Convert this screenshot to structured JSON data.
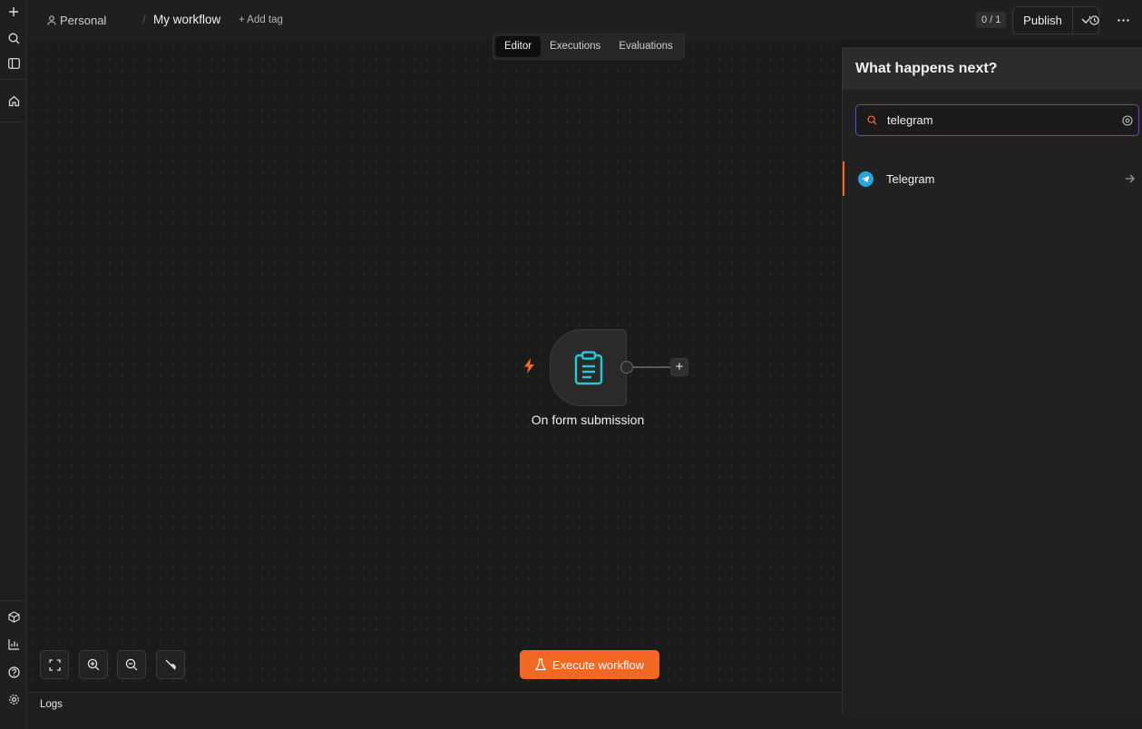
{
  "sidebar": {
    "icons": [
      "plus-icon",
      "search-icon",
      "panel-icon",
      "home-icon",
      "templates-icon",
      "insights-icon",
      "help-icon",
      "settings-icon"
    ]
  },
  "header": {
    "project": "Personal",
    "separator": "/",
    "workflow_name": "My workflow",
    "add_tag": "+ Add tag",
    "counter": "0 / 1",
    "publish_label": "Publish"
  },
  "tabs": [
    {
      "label": "Editor",
      "active": true
    },
    {
      "label": "Executions",
      "active": false
    },
    {
      "label": "Evaluations",
      "active": false
    }
  ],
  "node": {
    "label": "On form submission",
    "icon": "clipboard-icon"
  },
  "execute_label": "Execute workflow",
  "logs_label": "Logs",
  "panel": {
    "title": "What happens next?",
    "search_value": "telegram",
    "results": [
      {
        "label": "Telegram",
        "icon": "telegram-icon"
      }
    ]
  },
  "colors": {
    "accent": "#f26722",
    "search_focus": "#6d3fd6",
    "node_icon": "#2cc5d6",
    "telegram": "#2aa3df"
  }
}
